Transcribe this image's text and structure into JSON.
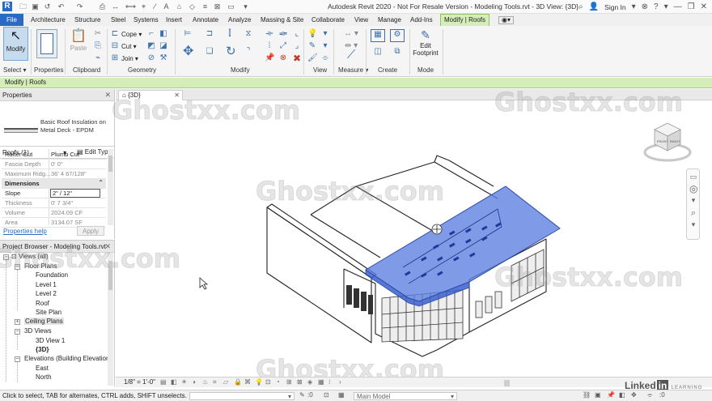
{
  "titlebar": {
    "app_letter": "R",
    "title": "Autodesk Revit 2020 - Not For Resale Version - Modeling Tools.rvt - 3D View: {3D}",
    "sign_in": "Sign In"
  },
  "ribbon_tabs": [
    "File",
    "Architecture",
    "Structure",
    "Steel",
    "Systems",
    "Insert",
    "Annotate",
    "Analyze",
    "Massing & Site",
    "Collaborate",
    "View",
    "Manage",
    "Add-Ins",
    "Modify | Roofs"
  ],
  "ribbon": {
    "modify_label": "Modify",
    "paste_label": "Paste",
    "cope_label": "Cope",
    "cut_label": "Cut",
    "join_label": "Join",
    "edit_footprint_label": "Edit Footprint",
    "panels": [
      "Select",
      "Properties",
      "Clipboard",
      "Geometry",
      "Modify",
      "View",
      "Measure",
      "Create",
      "Mode"
    ]
  },
  "context_label": "Modify | Roofs",
  "properties": {
    "title": "Properties",
    "type_name": "Basic Roof Insulation on Metal Deck - EPDM",
    "instance_label": "Roofs (1)",
    "edit_type_label": "Edit Type",
    "rows": [
      {
        "key": "Rafter Cut",
        "value": "Plumb Cut"
      },
      {
        "key": "Fascia Depth",
        "value": "0'  0\""
      },
      {
        "key": "Maximum Ridg...",
        "value": "36'  4 67/128\""
      },
      {
        "key": "Dimensions",
        "value": ""
      },
      {
        "key": "Slope",
        "value": "2\" / 12\""
      },
      {
        "key": "Thickness",
        "value": "0'  7 3/4\""
      },
      {
        "key": "Volume",
        "value": "2024.09 CF"
      },
      {
        "key": "Area",
        "value": "3134.07 SF"
      }
    ],
    "help_label": "Properties help",
    "apply_label": "Apply"
  },
  "browser": {
    "title": "Project Browser - Modeling Tools.rvt",
    "nodes": [
      "Views (all)",
      "Floor Plans",
      "Foundation",
      "Level 1",
      "Level 2",
      "Roof",
      "Site Plan",
      "Ceiling Plans",
      "3D Views",
      "3D View 1",
      "{3D}",
      "Elevations (Building Elevation",
      "East",
      "North"
    ]
  },
  "view": {
    "tab_label": "{3D}",
    "scale": "1/8\" = 1'-0\"",
    "viewcube_faces": [
      "FRONT",
      "RIGHT"
    ]
  },
  "status": {
    "text": "Click to select, TAB for alternates, CTRL adds, SHIFT unselects.",
    "workset_value": ":0",
    "model_label": "Main Model"
  },
  "watermark": "Ghostxx.com",
  "linkedin": {
    "brand": "Linked",
    "in": "in",
    "learning": "LEARNING"
  },
  "colors": {
    "file_tab": "#2a6ac2",
    "context": "#d5ecbb",
    "selection": "#3c5fd0"
  }
}
